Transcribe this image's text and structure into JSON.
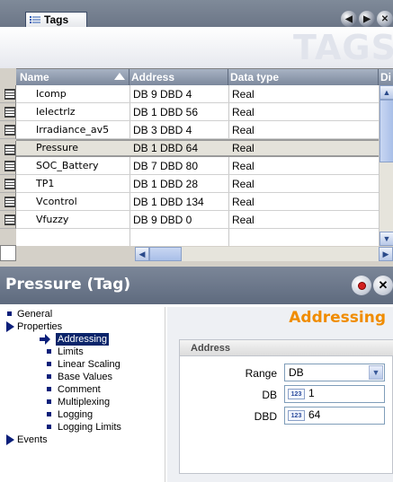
{
  "tags_window": {
    "tab_label": "Tags",
    "banner_title": "TAGS",
    "columns": [
      {
        "label": "Name"
      },
      {
        "label": "Address"
      },
      {
        "label": "Data type"
      },
      {
        "label": "Di"
      }
    ],
    "rows": [
      {
        "name": "Icomp",
        "address": "DB 9 DBD 4",
        "type": "Real"
      },
      {
        "name": "Ielectrlz",
        "address": "DB 1 DBD 56",
        "type": "Real"
      },
      {
        "name": "Irradiance_av5",
        "address": "DB 3 DBD 4",
        "type": "Real"
      },
      {
        "name": "Pressure",
        "address": "DB 1 DBD 64",
        "type": "Real"
      },
      {
        "name": "SOC_Battery",
        "address": "DB 7 DBD 80",
        "type": "Real"
      },
      {
        "name": "TP1",
        "address": "DB 1 DBD 28",
        "type": "Real"
      },
      {
        "name": "Vcontrol",
        "address": "DB 1 DBD 134",
        "type": "Real"
      },
      {
        "name": "Vfuzzy",
        "address": "DB 9 DBD 0",
        "type": "Real"
      }
    ],
    "selected_row": "Pressure"
  },
  "properties": {
    "title": "Pressure (Tag)",
    "tree": [
      {
        "label": "General"
      },
      {
        "label": "Properties"
      },
      {
        "label": "Addressing"
      },
      {
        "label": "Limits"
      },
      {
        "label": "Linear Scaling"
      },
      {
        "label": "Base Values"
      },
      {
        "label": "Comment"
      },
      {
        "label": "Multiplexing"
      },
      {
        "label": "Logging"
      },
      {
        "label": "Logging Limits"
      },
      {
        "label": "Events"
      }
    ],
    "section_title": "Addressing",
    "group_title": "Address",
    "range_label": "Range",
    "range_value": "DB",
    "db_label": "DB",
    "db_value": "1",
    "dbd_label": "DBD",
    "dbd_value": "64",
    "numeric_badge": "123"
  },
  "colors": {
    "accent": "#f08c00",
    "selection": "#0a246a",
    "header": "#7b8698"
  }
}
